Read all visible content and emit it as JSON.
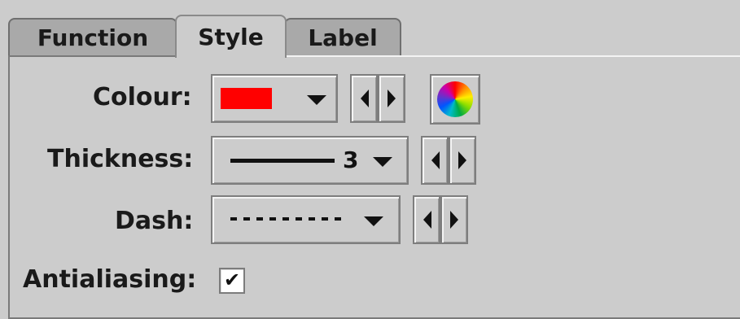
{
  "tabs": [
    {
      "label": "Function",
      "selected": false
    },
    {
      "label": "Style",
      "selected": true
    },
    {
      "label": "Label",
      "selected": false
    }
  ],
  "style_form": {
    "colour": {
      "label": "Colour:",
      "value_color": "#ff0000",
      "dropdown_icon": "chevron-down-icon",
      "prev_icon": "triangle-left-icon",
      "next_icon": "triangle-right-icon",
      "chooser_icon": "color-wheel-icon"
    },
    "thickness": {
      "label": "Thickness:",
      "value": "3",
      "dropdown_icon": "chevron-down-icon",
      "prev_icon": "triangle-left-icon",
      "next_icon": "triangle-right-icon"
    },
    "dash": {
      "label": "Dash:",
      "value_pattern": "dashed-line",
      "dropdown_icon": "chevron-down-icon",
      "prev_icon": "triangle-left-icon",
      "next_icon": "triangle-right-icon"
    },
    "antialiasing": {
      "label": "Antialiasing:",
      "checked": true,
      "check_glyph": "✔"
    }
  },
  "colors": {
    "panel_bg": "#cccccc",
    "tab_unselected_bg": "#a9a9a9",
    "text": "#1a1a1a",
    "swatch": "#ff0000"
  }
}
